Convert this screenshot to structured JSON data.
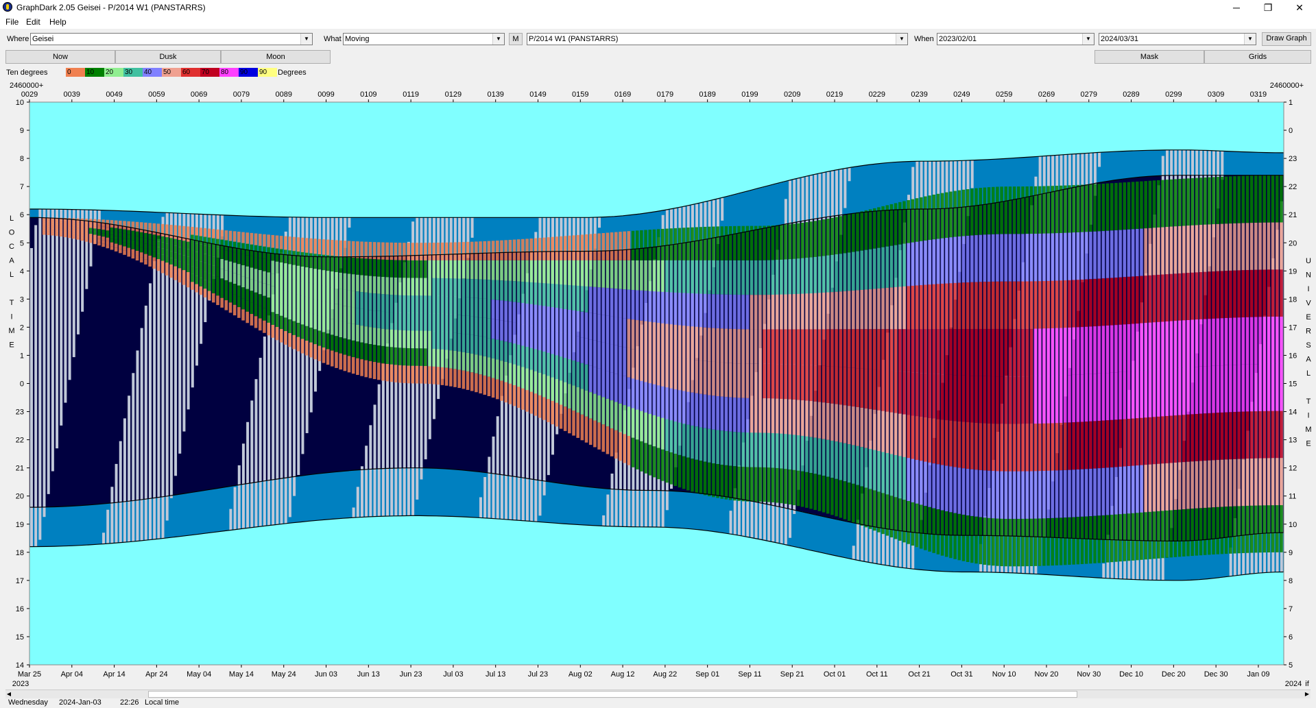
{
  "window": {
    "title": "GraphDark 2.05  Geisei  -  P/2014 W1 (PANSTARRS)",
    "minimize": "─",
    "maximize": "❐",
    "close": "✕"
  },
  "menu": [
    "File",
    "Edit",
    "Help"
  ],
  "toolbar": {
    "where_label": "Where",
    "where_value": "Geisei",
    "what_label": "What",
    "what_value": "Moving",
    "m_button": "M",
    "object_value": "P/2014 W1 (PANSTARRS)",
    "when_label": "When",
    "when_start": "2023/02/01",
    "when_end": "2024/03/31",
    "draw_button": "Draw Graph"
  },
  "buttons": {
    "now": "Now",
    "dusk": "Dusk",
    "moon": "Moon",
    "mask": "Mask",
    "grids": "Grids"
  },
  "legend": {
    "label": "Ten degrees",
    "suffix": "Degrees",
    "items": [
      {
        "text": "0",
        "color": "#f08050"
      },
      {
        "text": "10",
        "color": "#008000"
      },
      {
        "text": "20",
        "color": "#90ee90"
      },
      {
        "text": "30",
        "color": "#40c0a0"
      },
      {
        "text": "40",
        "color": "#8080ff"
      },
      {
        "text": "50",
        "color": "#f0a090"
      },
      {
        "text": "60",
        "color": "#e03030"
      },
      {
        "text": "70",
        "color": "#c00020"
      },
      {
        "text": "80",
        "color": "#ff40ff"
      },
      {
        "text": "90",
        "color": "#0000e0"
      },
      {
        "text": "90",
        "color": "#ffff80"
      }
    ]
  },
  "colors": {
    "day": "#80ffff",
    "twilight": "#0080c0",
    "night": "#000040",
    "moon": "#c0c8d8"
  },
  "chart_data": {
    "type": "heatmap",
    "top_axis_prefix_left": "2460000+",
    "top_axis_prefix_right": "2460000+",
    "top_ticks": [
      "0029",
      "0039",
      "0049",
      "0059",
      "0069",
      "0079",
      "0089",
      "0099",
      "0109",
      "0119",
      "0129",
      "0139",
      "0149",
      "0159",
      "0169",
      "0179",
      "0189",
      "0199",
      "0209",
      "0219",
      "0229",
      "0239",
      "0249",
      "0259",
      "0269",
      "0279",
      "0289",
      "0299",
      "0309",
      "0319"
    ],
    "bottom_ticks": [
      "Mar 25",
      "Apr 04",
      "Apr 14",
      "Apr 24",
      "May 04",
      "May 14",
      "May 24",
      "Jun 03",
      "Jun 13",
      "Jun 23",
      "Jul 03",
      "Jul 13",
      "Jul 23",
      "Aug 02",
      "Aug 12",
      "Aug 22",
      "Sep 01",
      "Sep 11",
      "Sep 21",
      "Oct 01",
      "Oct 11",
      "Oct 21",
      "Oct 31",
      "Nov 10",
      "Nov 20",
      "Nov 30",
      "Dec 10",
      "Dec 20",
      "Dec 30",
      "Jan 09"
    ],
    "year_left": "2023",
    "year_right": "2024",
    "right_corner": "if",
    "left_axis_title": [
      "L",
      "O",
      "C",
      "A",
      "L",
      "",
      "T",
      "I",
      "M",
      "E"
    ],
    "right_axis_title": [
      "U",
      "N",
      "I",
      "V",
      "E",
      "R",
      "S",
      "A",
      "L",
      "",
      "T",
      "I",
      "M",
      "E"
    ],
    "left_ticks": [
      "10",
      "9",
      "8",
      "7",
      "6",
      "5",
      "4",
      "3",
      "2",
      "1",
      "0",
      "23",
      "22",
      "21",
      "20",
      "19",
      "18",
      "17",
      "16",
      "15",
      "14"
    ],
    "right_ticks": [
      "1",
      "0",
      "23",
      "22",
      "21",
      "20",
      "19",
      "18",
      "17",
      "16",
      "15",
      "14",
      "13",
      "12",
      "11",
      "10",
      "9",
      "8",
      "7",
      "6",
      "5"
    ],
    "x_range_days": [
      29,
      325
    ],
    "y_range_local_hours": [
      14,
      34
    ]
  },
  "status": {
    "day": "Wednesday",
    "date": "2024-Jan-03",
    "time": "22:26",
    "tz": "Local time"
  }
}
